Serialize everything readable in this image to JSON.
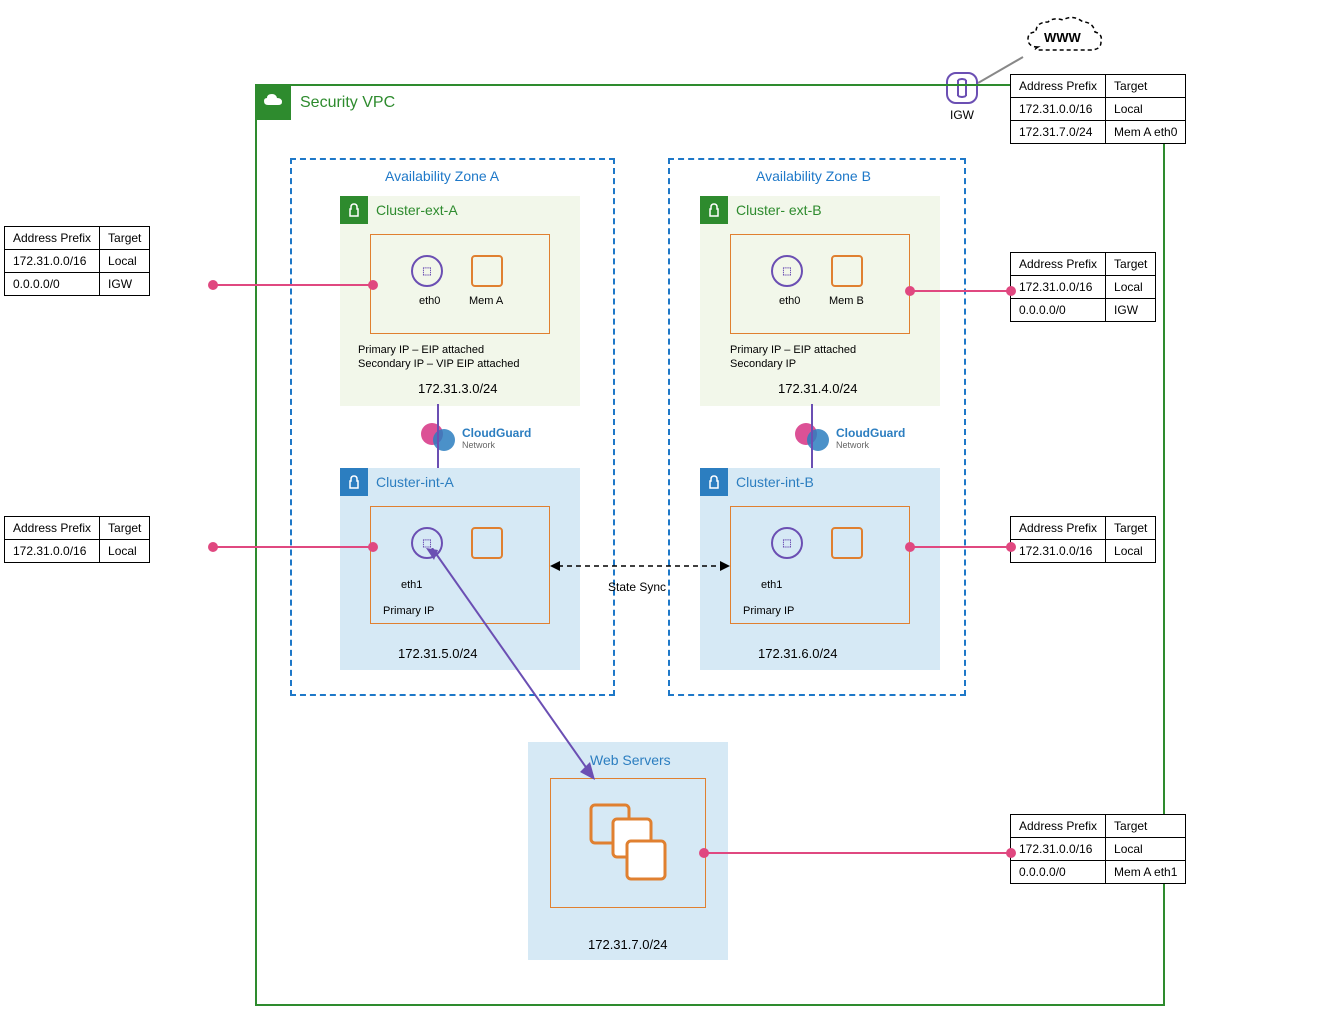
{
  "wwwLabel": "WWW",
  "igwLabel": "IGW",
  "vpcTitle": "Security VPC",
  "azA": "Availability Zone A",
  "azB": "Availability Zone B",
  "clusterExtA": "Cluster-ext-A",
  "clusterExtB": "Cluster- ext-B",
  "clusterIntA": "Cluster-int-A",
  "clusterIntB": "Cluster-int-B",
  "eth0": "eth0",
  "eth1": "eth1",
  "memA": "Mem A",
  "memB": "Mem B",
  "extAnoteA1": "Primary IP – EIP attached",
  "extAnoteA2": "Secondary IP – VIP EIP attached",
  "extBnoteB1": "Primary IP – EIP attached",
  "extBnoteB2": "Secondary IP",
  "primaryIP": "Primary IP",
  "cidrExtA": "172.31.3.0/24",
  "cidrExtB": "172.31.4.0/24",
  "cidrIntA": "172.31.5.0/24",
  "cidrIntB": "172.31.6.0/24",
  "cidrWeb": "172.31.7.0/24",
  "stateSync": "State Sync",
  "cloudGuard": "CloudGuard",
  "network": "Network",
  "webServers": "Web Servers",
  "headers": {
    "prefix": "Address Prefix",
    "target": "Target"
  },
  "rtTopLeft": {
    "rows": [
      [
        "172.31.0.0/16",
        "Local"
      ],
      [
        "0.0.0.0/0",
        "IGW"
      ]
    ]
  },
  "rtMidLeft": {
    "rows": [
      [
        "172.31.0.0/16",
        "Local"
      ]
    ]
  },
  "rtIGW": {
    "rows": [
      [
        "172.31.0.0/16",
        "Local"
      ],
      [
        "172.31.7.0/24",
        "Mem A eth0"
      ]
    ]
  },
  "rtTopRight": {
    "rows": [
      [
        "172.31.0.0/16",
        "Local"
      ],
      [
        "0.0.0.0/0",
        "IGW"
      ]
    ]
  },
  "rtMidRight": {
    "rows": [
      [
        "172.31.0.0/16",
        "Local"
      ]
    ]
  },
  "rtWeb": {
    "rows": [
      [
        "172.31.0.0/16",
        "Local"
      ],
      [
        "0.0.0.0/0",
        "Mem A eth1"
      ]
    ]
  }
}
